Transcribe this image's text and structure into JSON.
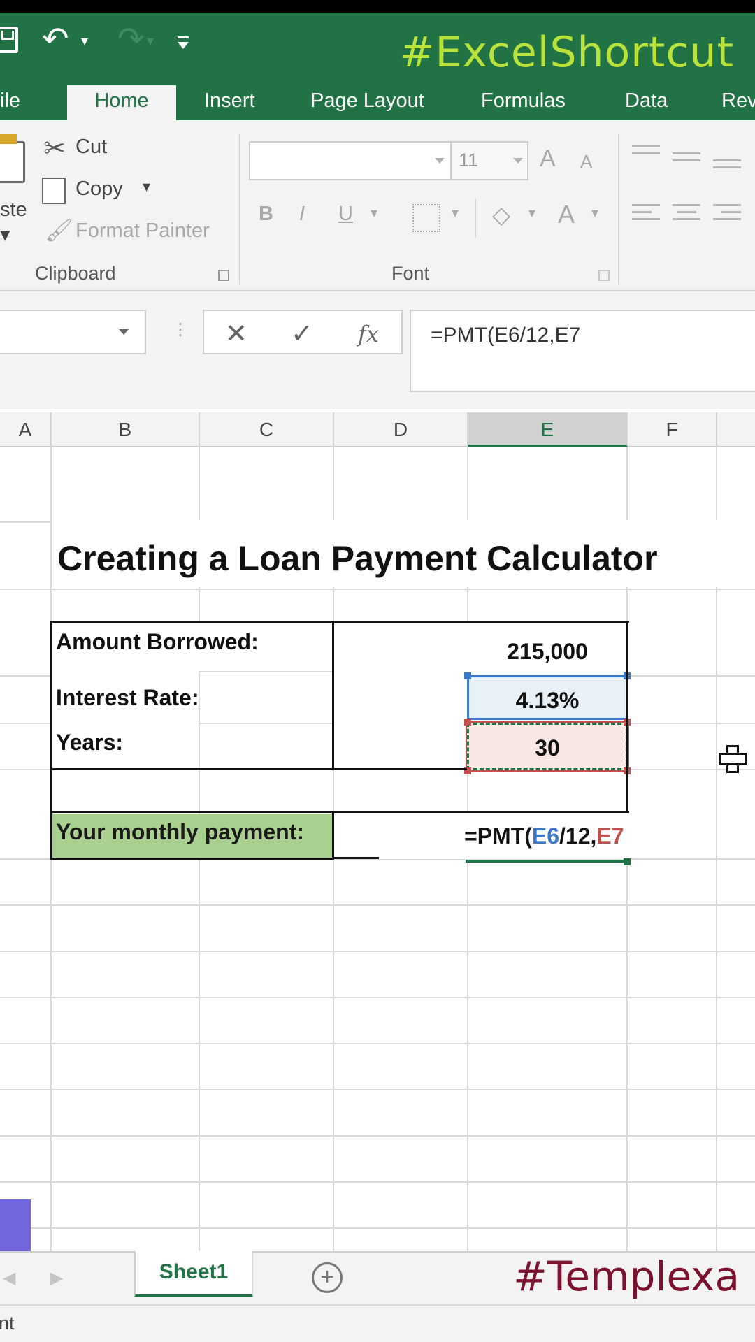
{
  "titlebar": {
    "hashtag": "#ExcelShortcut",
    "accent_color": "#217346",
    "hashtag_color": "#b9e33b"
  },
  "tabs": [
    {
      "label": "ile",
      "active": false
    },
    {
      "label": "Home",
      "active": true
    },
    {
      "label": "Insert",
      "active": false
    },
    {
      "label": "Page Layout",
      "active": false
    },
    {
      "label": "Formulas",
      "active": false
    },
    {
      "label": "Data",
      "active": false
    },
    {
      "label": "Rev",
      "active": false
    }
  ],
  "ribbon": {
    "clipboard": {
      "paste_label": "ste",
      "cut_label": "Cut",
      "copy_label": "Copy",
      "format_painter_label": "Format Painter",
      "group_label": "Clipboard"
    },
    "font": {
      "font_name": "",
      "font_size": "11",
      "bold": "B",
      "italic": "I",
      "underline": "U",
      "font_color": "A",
      "grow": "A",
      "shrink": "A",
      "group_label": "Font"
    }
  },
  "formula_bar": {
    "cancel": "✕",
    "enter": "✓",
    "fx": "fx",
    "formula": "=PMT(E6/12,E7"
  },
  "columns": [
    "A",
    "B",
    "C",
    "D",
    "E",
    "F"
  ],
  "selected_column": "E",
  "sheet": {
    "title": "Creating a Loan Payment Calculator",
    "rows": [
      {
        "label": "Amount Borrowed:",
        "value": "215,000"
      },
      {
        "label": "Interest Rate:",
        "value": "4.13%"
      },
      {
        "label": "Years:",
        "value": "30"
      }
    ],
    "payment_label": "Your monthly payment:",
    "payment_formula": {
      "prefix": "=PMT(",
      "ref1": "E6",
      "mid": "/12,",
      "ref2": "E7"
    },
    "payment_fill_color": "#a9d08e",
    "ref1_color": "#3a78c9",
    "ref2_color": "#c0504d"
  },
  "sheet_tabs": {
    "active_tab": "Sheet1",
    "add_icon": "+",
    "left_arrow": "◀",
    "right_arrow": "▶"
  },
  "watermark": {
    "hashtag": "#Templexa",
    "color": "#7c1230"
  },
  "status": {
    "text": "nt"
  }
}
